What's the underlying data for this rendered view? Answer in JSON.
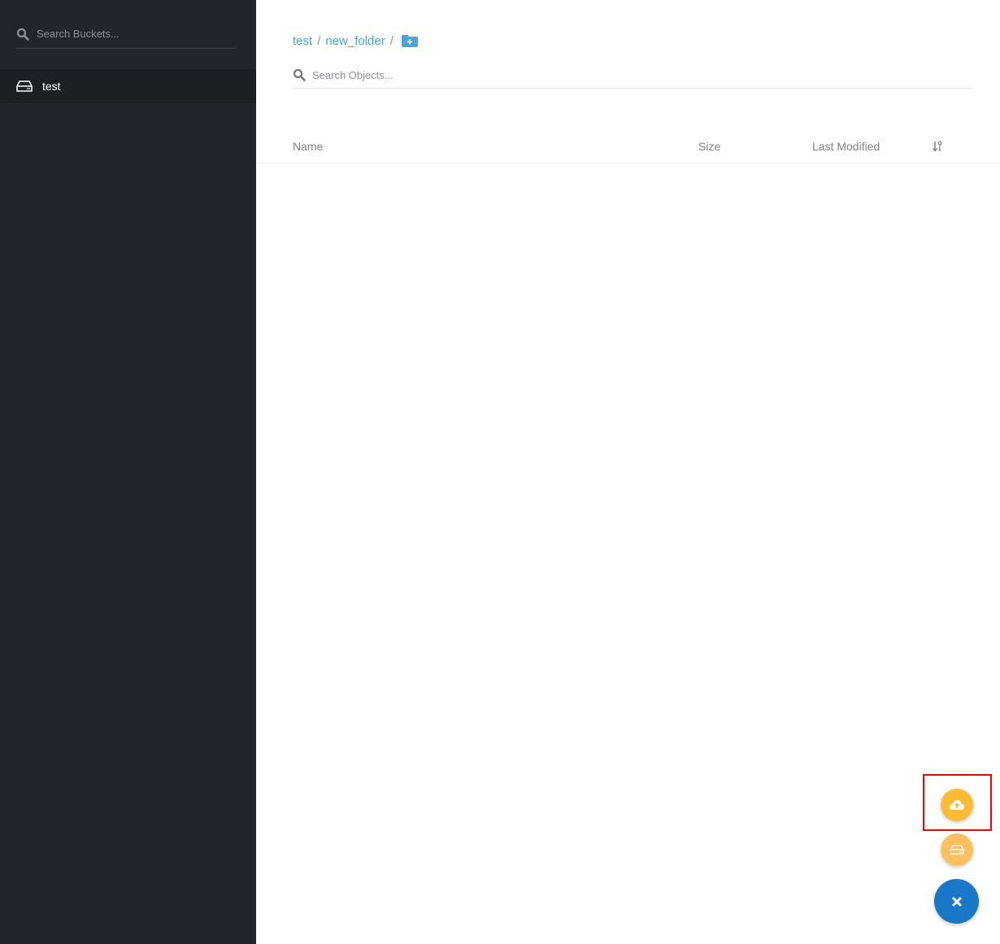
{
  "sidebar": {
    "search_placeholder": "Search Buckets...",
    "buckets": [
      {
        "name": "test",
        "icon": "hdd-icon"
      }
    ]
  },
  "breadcrumb": {
    "items": [
      "test",
      "new_folder"
    ],
    "separator": "/"
  },
  "objects": {
    "search_placeholder": "Search Objects..."
  },
  "table": {
    "columns": {
      "name": "Name",
      "size": "Size",
      "last_modified": "Last Modified"
    },
    "rows": []
  },
  "fab": {
    "upload_color": "#ffbb33",
    "create_bucket_color": "#ffc060",
    "close_color": "#1a78c9"
  }
}
